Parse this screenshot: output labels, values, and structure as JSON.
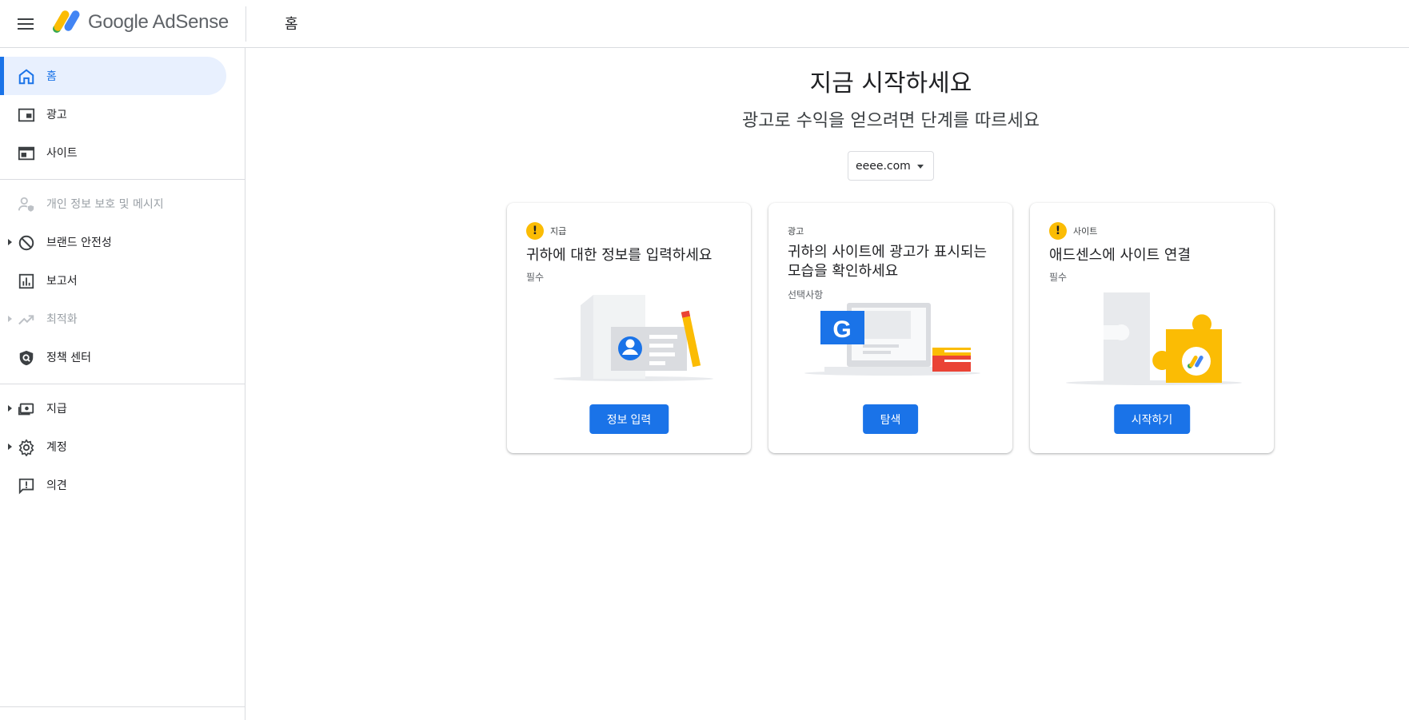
{
  "header": {
    "logo_text": "Google AdSense",
    "page_title": "홈"
  },
  "sidebar": {
    "items": [
      {
        "label": "홈",
        "icon": "home-icon",
        "active": true
      },
      {
        "label": "광고",
        "icon": "ads-icon"
      },
      {
        "label": "사이트",
        "icon": "sites-icon"
      },
      {
        "label": "개인 정보 보호 및 메시지",
        "icon": "privacy-icon",
        "disabled": true
      },
      {
        "label": "브랜드 안전성",
        "icon": "block-icon",
        "expandable": true
      },
      {
        "label": "보고서",
        "icon": "reports-icon"
      },
      {
        "label": "최적화",
        "icon": "trending-icon",
        "disabled": true,
        "expandable": true
      },
      {
        "label": "정책 센터",
        "icon": "policy-shield-icon"
      },
      {
        "label": "지급",
        "icon": "payments-icon",
        "expandable": true
      },
      {
        "label": "계정",
        "icon": "gear-icon",
        "expandable": true
      },
      {
        "label": "의견",
        "icon": "feedback-icon"
      }
    ]
  },
  "main": {
    "title": "지금 시작하세요",
    "subtitle": "광고로 수익을 얻으려면 단계를 따르세요",
    "site_select": "eeee.com",
    "cards": [
      {
        "tag": "지급",
        "title": "귀하에 대한 정보를 입력하세요",
        "requirement": "필수",
        "button": "정보 입력",
        "warning": true
      },
      {
        "tag": "광고",
        "title": "귀하의 사이트에 광고가 표시되는 모습을 확인하세요",
        "requirement": "선택사항",
        "button": "탐색",
        "warning": false
      },
      {
        "tag": "사이트",
        "title": "애드센스에 사이트 연결",
        "requirement": "필수",
        "button": "시작하기",
        "warning": true
      }
    ]
  },
  "colors": {
    "accent": "#1a73e8",
    "warning": "#fbbc04",
    "active_bg": "#e8f0fe"
  }
}
